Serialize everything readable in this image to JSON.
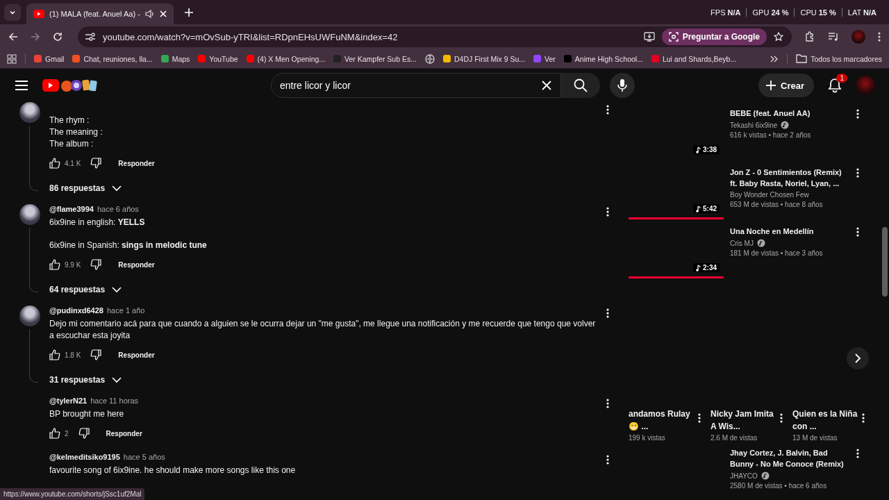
{
  "browser": {
    "tab": {
      "title": "(1) MALA (feat. Anuel Aa) -",
      "audio": true
    },
    "perf": [
      {
        "label": "FPS",
        "value": "N/A"
      },
      {
        "label": "GPU",
        "value": "24 %"
      },
      {
        "label": "CPU",
        "value": "15 %"
      },
      {
        "label": "LAT",
        "value": "N/A"
      }
    ],
    "url": "youtube.com/watch?v=mOvSub-yTRI&list=RDpnEHsUWFuNM&index=42",
    "ask_button": "Preguntar a Google",
    "bookmarks": [
      {
        "label": "Gmail",
        "kind": "gmail"
      },
      {
        "label": "Chat, reuniones, lla...",
        "kind": "grid"
      },
      {
        "label": "Maps",
        "kind": "maps"
      },
      {
        "label": "YouTube",
        "kind": "youtube"
      },
      {
        "label": "(4) X Men Opening...",
        "kind": "youtube"
      },
      {
        "label": "Ver Kampfer Sub Es...",
        "kind": "af"
      },
      {
        "kind": "globe"
      },
      {
        "label": "D4DJ First Mix 9 Su...",
        "kind": "star"
      },
      {
        "label": "Ver",
        "kind": "twitch"
      },
      {
        "label": "Anime High School...",
        "kind": "tiktok"
      },
      {
        "label": "Lui and Shards,Beyb...",
        "kind": "pinterest"
      }
    ],
    "all_bookmarks": "Todos los marcadores"
  },
  "youtube": {
    "search": {
      "value": "entre licor y licor"
    },
    "create": "Crear",
    "notifications": "1"
  },
  "comments": [
    {
      "avatar": true,
      "paragraphs": [
        "The rhym :\nThe meaning :\nThe album :"
      ],
      "likes": "4.1 K",
      "reply": "Responder",
      "replies": "86 respuestas"
    },
    {
      "author": "@flame3994",
      "time": "hace 6 años",
      "avatar": true,
      "paragraphs": [
        "6ix9ine in english: **YELLS**",
        "6ix9ine in Spanish: **sings in melodic tune**"
      ],
      "likes": "9.9 K",
      "reply": "Responder",
      "replies": "64 respuestas"
    },
    {
      "author": "@pudinxd6428",
      "time": "hace 1 año",
      "avatar": true,
      "paragraphs": [
        "Dejo mi comentario acá para que cuando a alguien se le ocurra dejar un \"me gusta\", me llegue una notificación y me recuerde que tengo que volver a escuchar esta joyita"
      ],
      "likes": "1.8 K",
      "reply": "Responder",
      "replies": "31 respuestas"
    },
    {
      "author": "@tylerN21",
      "time": "hace 11 horas",
      "avatar": false,
      "paragraphs": [
        "BP brought me here"
      ],
      "likes": "2",
      "reply": "Responder"
    },
    {
      "author": "@kelmeditsiko9195",
      "time": "hace 5 años",
      "avatar": false,
      "paragraphs": [
        "favourite song of 6ix9ine. he should make more songs like this one"
      ]
    }
  ],
  "sidebar": {
    "videos": [
      {
        "title": "BEBE (feat. Anuel AA)",
        "channel": "Tekashi 6ix9ine",
        "verified": true,
        "meta": "616 k vistas • hace 2 años",
        "duration": "3:38"
      },
      {
        "title": "Jon Z - 0 Sentimientos (Remix) ft. Baby Rasta, Noriel, Lyan, ...",
        "channel": "Boy Wonder Chosen Few",
        "verified": false,
        "meta": "653 M de vistas • hace 8 años",
        "duration": "5:42",
        "level": 1
      },
      {
        "title": "Una Noche en Medellín",
        "channel": "Cris MJ",
        "verified": true,
        "meta": "181 M de vistas • hace 3 años",
        "duration": "2:34",
        "level": 1
      }
    ],
    "shorts": [
      {
        "title": "andamos Rulay😁 ...",
        "views": "199 k vistas"
      },
      {
        "title": "Nicky Jam Imita A Wis...",
        "views": "2.6 M de vistas"
      },
      {
        "title": "Quien es la Niña con ...",
        "views": "13 M de vistas"
      }
    ],
    "more_videos": [
      {
        "title": "Jhay Cortez, J. Balvin, Bad Bunny - No Me Conoce (Remix)",
        "channel": "JHAYCO",
        "verified": true,
        "meta": "2580 M de vistas • hace 6 años"
      }
    ]
  },
  "status_url": "https://www.youtube.com/shorts/jSsc1uf2Mal"
}
